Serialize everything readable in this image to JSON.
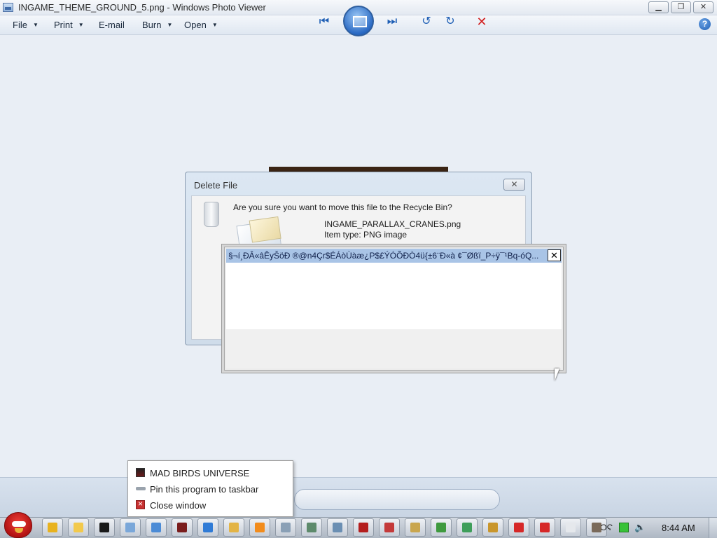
{
  "window": {
    "title": "INGAME_THEME_GROUND_5.png - Windows Photo Viewer",
    "minimize_glyph": "▁",
    "maximize_glyph": "❐",
    "close_glyph": "✕"
  },
  "menubar": {
    "items": [
      {
        "label": "File",
        "has_arrow": true
      },
      {
        "label": "Print",
        "has_arrow": true
      },
      {
        "label": "E-mail",
        "has_arrow": false
      },
      {
        "label": "Burn",
        "has_arrow": true
      },
      {
        "label": "Open",
        "has_arrow": true
      }
    ],
    "arrow_glyph": "▼",
    "help_glyph": "?"
  },
  "delete_dialog": {
    "title": "Delete File",
    "close_glyph": "✕",
    "question": "Are you sure you want to move this file to the Recycle Bin?",
    "file_name": "INGAME_PARALLAX_CRANES.png",
    "file_type": "Item type: PNG image"
  },
  "popup": {
    "title": "§¬í¸ÐÂ«âÊyŠöÐ ®@n4Çr$ÉÁòÙàæ¿P$£ÝÓÕÐÒ4ü{±6¨Ð«à ¢¯Øßï_P÷ÿ¯¹Bq-óQ...",
    "close_glyph": "✕"
  },
  "controls": {
    "prev_glyph": "⏮",
    "next_glyph": "⏭",
    "rotate_ccw_glyph": "↺",
    "rotate_cw_glyph": "↻",
    "delete_glyph": "✕"
  },
  "jumplist": {
    "items": [
      {
        "label": "MAD BIRDS UNIVERSE",
        "icon": "app-icon"
      },
      {
        "label": "Pin this program to taskbar",
        "icon": "pin-icon"
      },
      {
        "label": "Close window",
        "icon": "close-window-icon"
      }
    ]
  },
  "taskbar": {
    "clock": "8:44 AM",
    "buttons": [
      {
        "name": "chrome-icon",
        "color": "#e8b21f"
      },
      {
        "name": "folder-smiley-icon",
        "color": "#f2c94c"
      },
      {
        "name": "7zip-icon",
        "color": "#1a1a1a"
      },
      {
        "name": "notepad-icon",
        "color": "#7aa7d9"
      },
      {
        "name": "paint-icon",
        "color": "#4b8bd6"
      },
      {
        "name": "game-icon",
        "color": "#7a1d1d"
      },
      {
        "name": "internet-explorer-icon",
        "color": "#2f7bd6"
      },
      {
        "name": "explorer-icon",
        "color": "#e3b446"
      },
      {
        "name": "media-player-icon",
        "color": "#f28c1c"
      },
      {
        "name": "tool-icon",
        "color": "#8aa0b6"
      },
      {
        "name": "window-icon",
        "color": "#5d8a6b"
      },
      {
        "name": "window-icon-2",
        "color": "#6b8fb3"
      },
      {
        "name": "filezilla-icon",
        "color": "#b41e1e"
      },
      {
        "name": "bug-icon",
        "color": "#c43a3a"
      },
      {
        "name": "image-icon",
        "color": "#c9a64f"
      },
      {
        "name": "globe-icon",
        "color": "#3f9a3f"
      },
      {
        "name": "recycle-icon",
        "color": "#3e9e5a"
      },
      {
        "name": "package-icon",
        "color": "#c9962c"
      },
      {
        "name": "error-icon",
        "color": "#d62828"
      },
      {
        "name": "error-icon-2",
        "color": "#d62828"
      },
      {
        "name": "blank-icon",
        "color": "#e5e8ec"
      },
      {
        "name": "network-icon",
        "color": "#7a6a5a"
      }
    ]
  }
}
